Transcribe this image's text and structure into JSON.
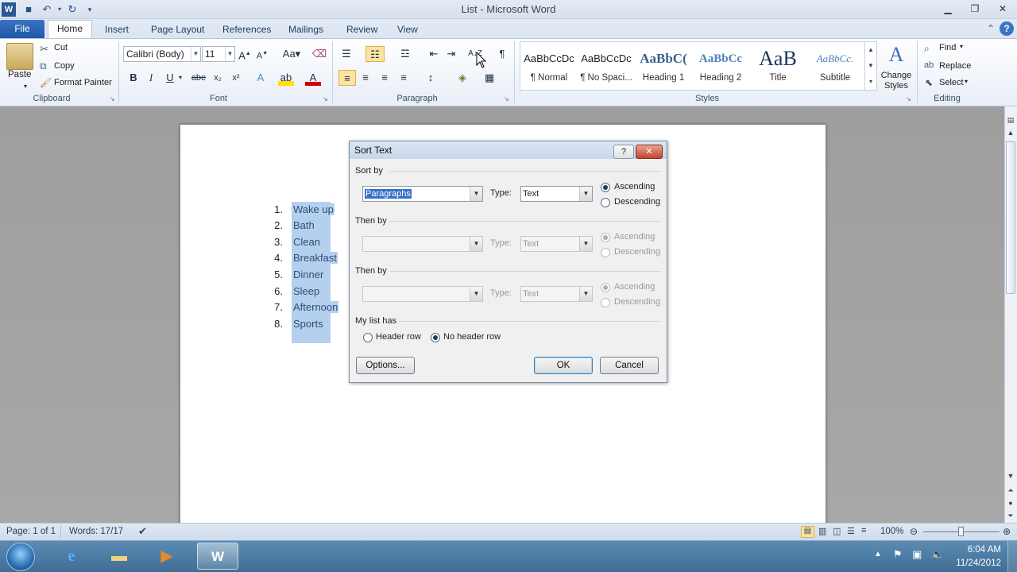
{
  "window": {
    "title": "List - Microsoft Word"
  },
  "tabs": [
    "File",
    "Home",
    "Insert",
    "Page Layout",
    "References",
    "Mailings",
    "Review",
    "View"
  ],
  "ribbon": {
    "clipboard": {
      "paste": "Paste",
      "cut": "Cut",
      "copy": "Copy",
      "format_painter": "Format Painter",
      "label": "Clipboard"
    },
    "font": {
      "name": "Calibri (Body)",
      "size": "11",
      "label": "Font"
    },
    "paragraph": {
      "label": "Paragraph"
    },
    "styles": {
      "items": [
        {
          "sample": "AaBbCcDc",
          "name": "¶ Normal"
        },
        {
          "sample": "AaBbCcDc",
          "name": "¶ No Spaci..."
        },
        {
          "sample": "AaBbC(",
          "name": "Heading 1"
        },
        {
          "sample": "AaBbCc",
          "name": "Heading 2"
        },
        {
          "sample": "AaB",
          "name": "Title"
        },
        {
          "sample": "AaBbCc.",
          "name": "Subtitle"
        }
      ],
      "change_styles": "Change Styles",
      "label": "Styles"
    },
    "editing": {
      "find": "Find",
      "replace": "Replace",
      "select": "Select",
      "label": "Editing"
    }
  },
  "document": {
    "list": [
      {
        "num": "1.",
        "text": "Wake up"
      },
      {
        "num": "2.",
        "text": "Bath"
      },
      {
        "num": "3.",
        "text": "Clean"
      },
      {
        "num": "4.",
        "text": "Breakfast"
      },
      {
        "num": "5.",
        "text": "Dinner"
      },
      {
        "num": "6.",
        "text": "Sleep"
      },
      {
        "num": "7.",
        "text": "Afternoon"
      },
      {
        "num": "8.",
        "text": "Sports"
      }
    ]
  },
  "dialog": {
    "title": "Sort Text",
    "sort_by_label": "Sort by",
    "sort_by_value": "Paragraphs",
    "type_label": "Type:",
    "type_value": "Text",
    "ascending": "Ascending",
    "descending": "Descending",
    "then_by_1": "Then by",
    "then_by_2": "Then by",
    "my_list_has": "My list has",
    "header_row": "Header row",
    "no_header_row": "No header row",
    "options": "Options...",
    "ok": "OK",
    "cancel": "Cancel"
  },
  "status": {
    "page": "Page: 1 of 1",
    "words": "Words: 17/17",
    "zoom": "100%"
  },
  "taskbar": {
    "time": "6:04 AM",
    "date": "11/24/2012"
  },
  "colors": {
    "file_tab": "#2a63b3",
    "selection": "#b5d0ee"
  }
}
